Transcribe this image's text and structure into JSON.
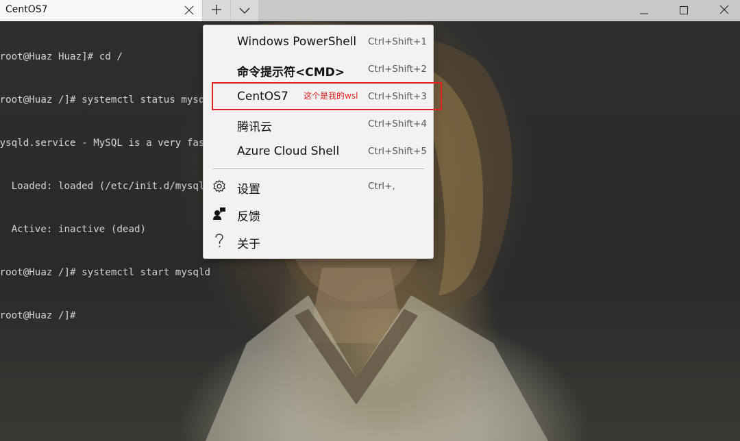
{
  "tab": {
    "title": "CentOS7"
  },
  "icons": {
    "tab_close": "close-icon",
    "new_tab": "plus-icon",
    "dropdown": "chevron-down-icon",
    "minimize": "minimize-icon",
    "maximize": "maximize-icon",
    "close": "close-icon"
  },
  "terminal": {
    "lines": [
      "[root@Huaz Huaz]# cd /",
      "[root@Huaz /]# systemctl status mysqld",
      "mysqld.service - MySQL is a very fast",
      "   Loaded: loaded (/etc/init.d/mysqld",
      "   Active: inactive (dead)",
      "[root@Huaz /]# systemctl start mysqld",
      "[root@Huaz /]#"
    ]
  },
  "menu": {
    "profiles": [
      {
        "label": "Windows PowerShell",
        "shortcut": "Ctrl+Shift+1"
      },
      {
        "label": "命令提示符<CMD>",
        "shortcut": "Ctrl+Shift+2"
      },
      {
        "label": "CentOS7",
        "shortcut": "Ctrl+Shift+3"
      },
      {
        "label": "腾讯云",
        "shortcut": "Ctrl+Shift+4"
      },
      {
        "label": "Azure Cloud Shell",
        "shortcut": "Ctrl+Shift+5"
      }
    ],
    "settings": {
      "label": "设置",
      "shortcut": "Ctrl+,",
      "icon": "gear-icon"
    },
    "feedback": {
      "label": "反馈",
      "icon": "feedback-icon"
    },
    "about": {
      "label": "关于",
      "icon": "question-icon"
    }
  },
  "annotation": {
    "text": "这个是我的wsl",
    "color": "#e0201c"
  },
  "colors": {
    "tab_bg": "#f7f7f7",
    "titlebar_bg": "#c8c8c8",
    "menu_bg": "#f2f2f2",
    "terminal_text": "#d4d4d4"
  }
}
